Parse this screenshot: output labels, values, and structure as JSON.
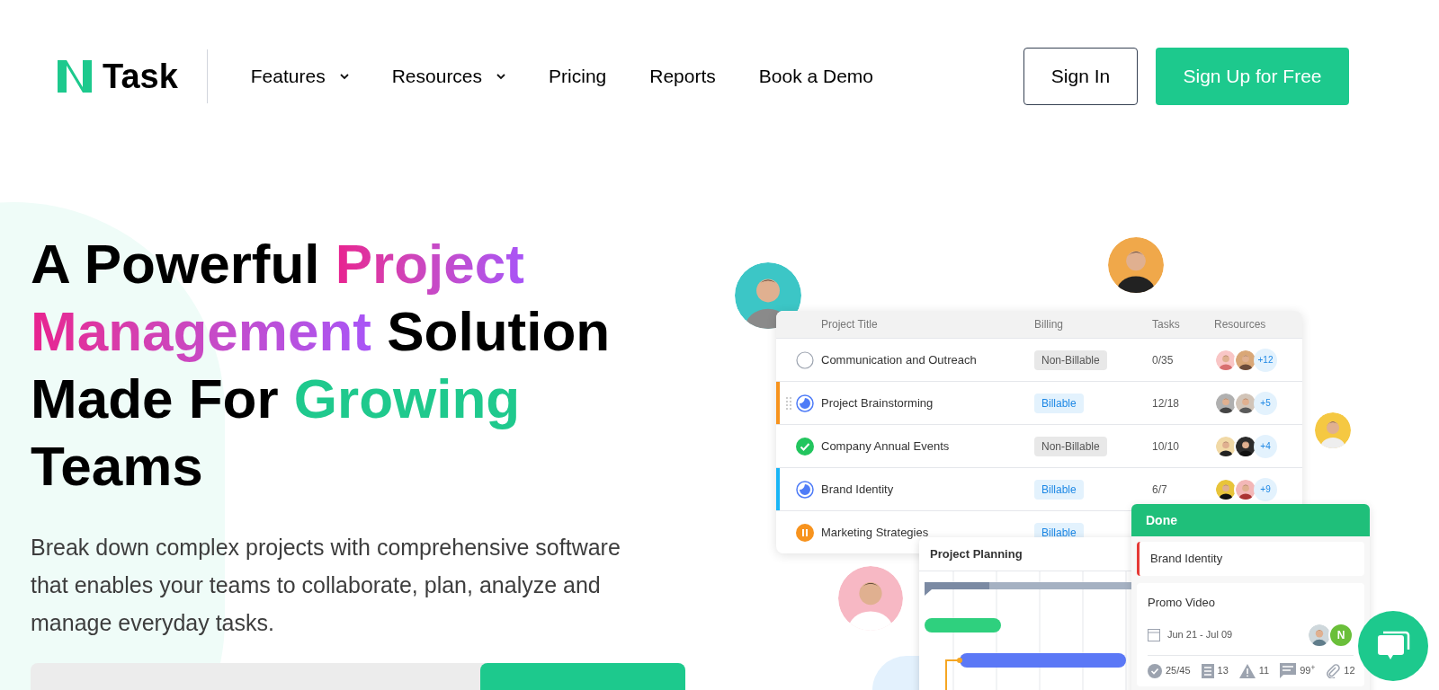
{
  "header": {
    "logo": "Task",
    "nav": [
      {
        "label": "Features",
        "kind": "dropdown"
      },
      {
        "label": "Resources",
        "kind": "dropdown"
      },
      {
        "label": "Pricing",
        "kind": "link"
      },
      {
        "label": "Reports",
        "kind": "link"
      },
      {
        "label": "Book a Demo",
        "kind": "link"
      }
    ],
    "sign_in": "Sign In",
    "sign_up": "Sign Up for Free"
  },
  "hero": {
    "heading": [
      [
        {
          "text": "A Powerful ",
          "kind": "plain"
        },
        {
          "text": "Project",
          "kind": "pink"
        }
      ],
      [
        {
          "text": "Management",
          "kind": "pink"
        },
        {
          "text": " Solution",
          "kind": "plain"
        }
      ],
      [
        {
          "text": "Made For ",
          "kind": "plain"
        },
        {
          "text": "Growing",
          "kind": "green"
        }
      ],
      [
        {
          "text": "Teams",
          "kind": "plain"
        }
      ]
    ],
    "description": "Break down complex projects with comprehensive software that enables your teams to collaborate, plan, analyze and manage everyday tasks."
  },
  "project_table": {
    "columns": [
      "Project Title",
      "Billing",
      "Tasks",
      "Resources"
    ],
    "rows": [
      {
        "title": "Communication and Outreach",
        "kind": "todo",
        "billing": "Non-Billable",
        "billable": false,
        "tasks": "0/35",
        "extra": "+12",
        "drag_handle": false
      },
      {
        "title": "Project Brainstorming",
        "kind": "in_progress",
        "billing": "Billable",
        "billable": true,
        "tasks": "12/18",
        "extra": "+5",
        "color": "#f7931e",
        "drag_handle": true
      },
      {
        "title": "Company Annual Events",
        "kind": "done",
        "billing": "Non-Billable",
        "billable": false,
        "tasks": "10/10",
        "extra": "+4",
        "drag_handle": false
      },
      {
        "title": "Brand Identity",
        "kind": "in_progress",
        "billing": "Billable",
        "billable": true,
        "tasks": "6/7",
        "extra": "+9",
        "color": "#19b5f5",
        "drag_handle": false
      },
      {
        "title": "Marketing Strategies",
        "kind": "paused",
        "billing": "Billable",
        "billable": true,
        "tasks": "",
        "extra": "",
        "drag_handle": false
      }
    ]
  },
  "gantt": {
    "title": "Project Planning"
  },
  "board": {
    "column": "Done",
    "cards": [
      {
        "title": "Brand Identity",
        "color": "#e53935"
      }
    ],
    "detail_card": {
      "title": "Promo Video",
      "date": "Jun 21 - Jul 09",
      "assignee_initial": "N",
      "stats": [
        {
          "kind": "check",
          "text": "25/45"
        },
        {
          "kind": "list",
          "text": "13"
        },
        {
          "kind": "warning",
          "text": "11"
        },
        {
          "kind": "comment",
          "text": "99$^{+}$"
        },
        {
          "kind": "attachment",
          "text": "12"
        }
      ]
    }
  }
}
